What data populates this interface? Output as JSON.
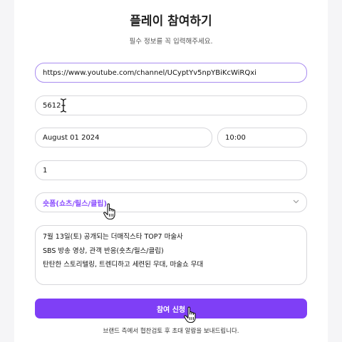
{
  "form": {
    "title": "플레이 참여하기",
    "subtitle": "필수 정보를 꼭 입력해주세요.",
    "channel_url": "https://www.youtube.com/channel/UCyptYv5npYBiKcWiRQxi",
    "code": "5612",
    "date": "August 01 2024",
    "time": "10:00",
    "count": "1",
    "category_selected": "숏폼(쇼츠/릴스/클립)",
    "description_lines": [
      "7월 13일(토) 공개되는 더매직스타 TOP7 마술사",
      "SBS 방송 영상, 관객 반응(숏츠/릴스/클립)",
      "탄탄한 스토리텔링, 트렌디하고 세련된 무대, 마술쇼 무대"
    ],
    "submit_label": "참여 신청",
    "footnote": "브랜드 측에서 협찬검토 후 초대 알람을 보내드립니다."
  },
  "icons": {
    "select_chevron": "chevron-down-icon",
    "text_cursor": "text-cursor-icon",
    "pointer": "hand-pointer-icon"
  },
  "colors": {
    "accent": "#7f3ff6",
    "select_text": "#8b4dff",
    "active_border": "#a98cf0"
  }
}
